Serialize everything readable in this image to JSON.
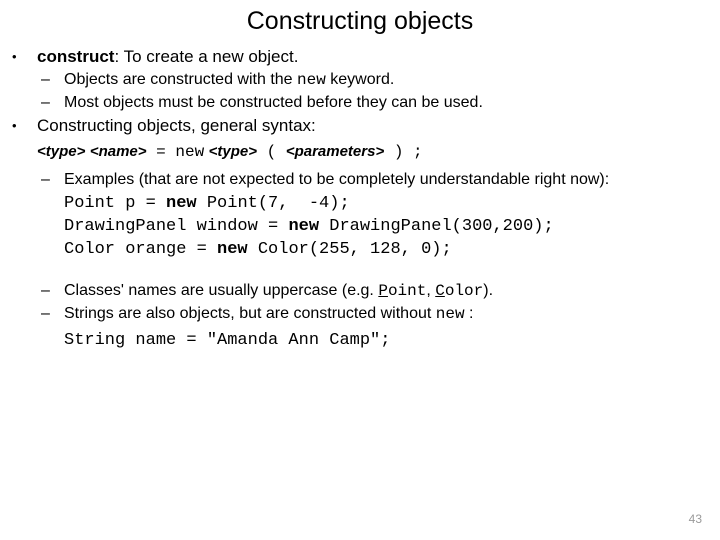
{
  "slide": {
    "title": "Constructing objects",
    "page_number": "43",
    "bullet_glyph": "•",
    "dash_glyph": "–",
    "content": {
      "b1_label": "construct",
      "b1_rest": ": To create a new object.",
      "b1_s1_pre": "Objects are constructed with the ",
      "b1_s1_kw": "new",
      "b1_s1_post": " keyword.",
      "b1_s2": "Most objects must be constructed before they can be used.",
      "b2_text": "Constructing objects, general syntax:",
      "syntax": {
        "type1": "<type>",
        "name": "<name>",
        "equals": " = ",
        "new": "new",
        "type2": "<type>",
        "paren_open": " ( ",
        "parameters": "<parameters>",
        "paren_close": " ) ;"
      },
      "b2_s1": "Examples (that are not expected to be completely understandable right now):",
      "code": [
        {
          "pre": "Point p = ",
          "kw": "new",
          "post": " Point(7,  -4);"
        },
        {
          "pre": "DrawingPanel window = ",
          "kw": "new",
          "post": " DrawingPanel(300,200);"
        },
        {
          "pre": "Color orange = ",
          "kw": "new",
          "post": " Color(255, 128, 0);"
        }
      ],
      "b3_pre": "Classes' names are usually uppercase (e.g. ",
      "b3_cls1_first": "P",
      "b3_cls1_rest": "oint",
      "b3_sep": ", ",
      "b3_cls2_first": "C",
      "b3_cls2_rest": "olor",
      "b3_post": ").",
      "b4_pre": "Strings are also objects, but are constructed without ",
      "b4_kw": "new",
      "b4_post": " :",
      "b4_code": "String name = \"Amanda Ann Camp\";"
    }
  }
}
